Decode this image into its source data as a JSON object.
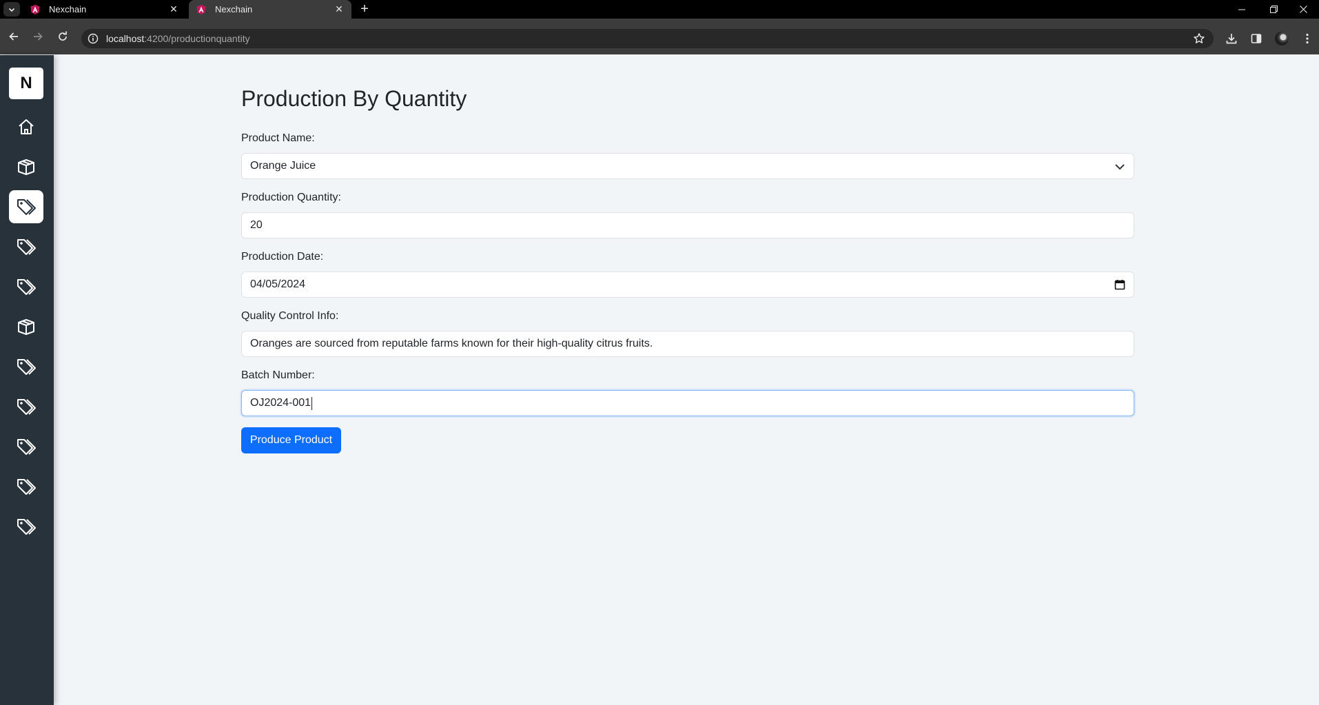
{
  "browser": {
    "tabs": [
      {
        "title": "Nexchain",
        "active": false
      },
      {
        "title": "Nexchain",
        "active": true
      }
    ],
    "url_host": "localhost",
    "url_rest": ":4200/productionquantity"
  },
  "sidebar": {
    "logo": "N",
    "items": [
      {
        "icon": "home-icon"
      },
      {
        "icon": "box-icon"
      },
      {
        "icon": "tags-icon",
        "active": true
      },
      {
        "icon": "tags-icon"
      },
      {
        "icon": "tags-icon"
      },
      {
        "icon": "box-icon"
      },
      {
        "icon": "tags-icon"
      },
      {
        "icon": "tags-icon"
      },
      {
        "icon": "tags-icon"
      },
      {
        "icon": "tags-icon"
      },
      {
        "icon": "tags-icon"
      }
    ]
  },
  "form": {
    "title": "Production By Quantity",
    "product_name": {
      "label": "Product Name:",
      "value": "Orange Juice"
    },
    "quantity": {
      "label": "Production Quantity:",
      "value": "20"
    },
    "date": {
      "label": "Production Date:",
      "value": "04/05/2024"
    },
    "quality": {
      "label": "Quality Control Info:",
      "value": "Oranges are sourced from reputable farms known for their high-quality citrus fruits."
    },
    "batch": {
      "label": "Batch Number:",
      "value": "OJ2024-001"
    },
    "submit_label": "Produce Product"
  },
  "colors": {
    "sidebar_bg": "#27323a",
    "page_bg": "#f2f5f8",
    "primary": "#0d6efd"
  }
}
